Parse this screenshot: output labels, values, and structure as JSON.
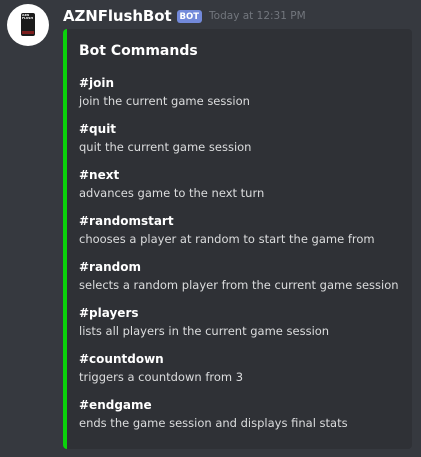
{
  "message": {
    "author": "AZNFlushBot",
    "bot_tag": "BOT",
    "timestamp": "Today at 12:31 PM",
    "avatar_icon": "card-avatar-icon",
    "avatar_text": "AZN FLUSH"
  },
  "embed": {
    "accent_color": "#0bd20b",
    "title": "Bot Commands",
    "fields": [
      {
        "name": "#join",
        "value": "join the current game session"
      },
      {
        "name": "#quit",
        "value": "quit the current game session"
      },
      {
        "name": "#next",
        "value": "advances game to the next turn"
      },
      {
        "name": "#randomstart",
        "value": "chooses a player at random to start the game from"
      },
      {
        "name": "#random",
        "value": "selects a random player from the current game session"
      },
      {
        "name": "#players",
        "value": "lists all players in the current game session"
      },
      {
        "name": "#countdown",
        "value": "triggers a countdown from 3"
      },
      {
        "name": "#endgame",
        "value": "ends the game session and displays final stats"
      }
    ]
  }
}
